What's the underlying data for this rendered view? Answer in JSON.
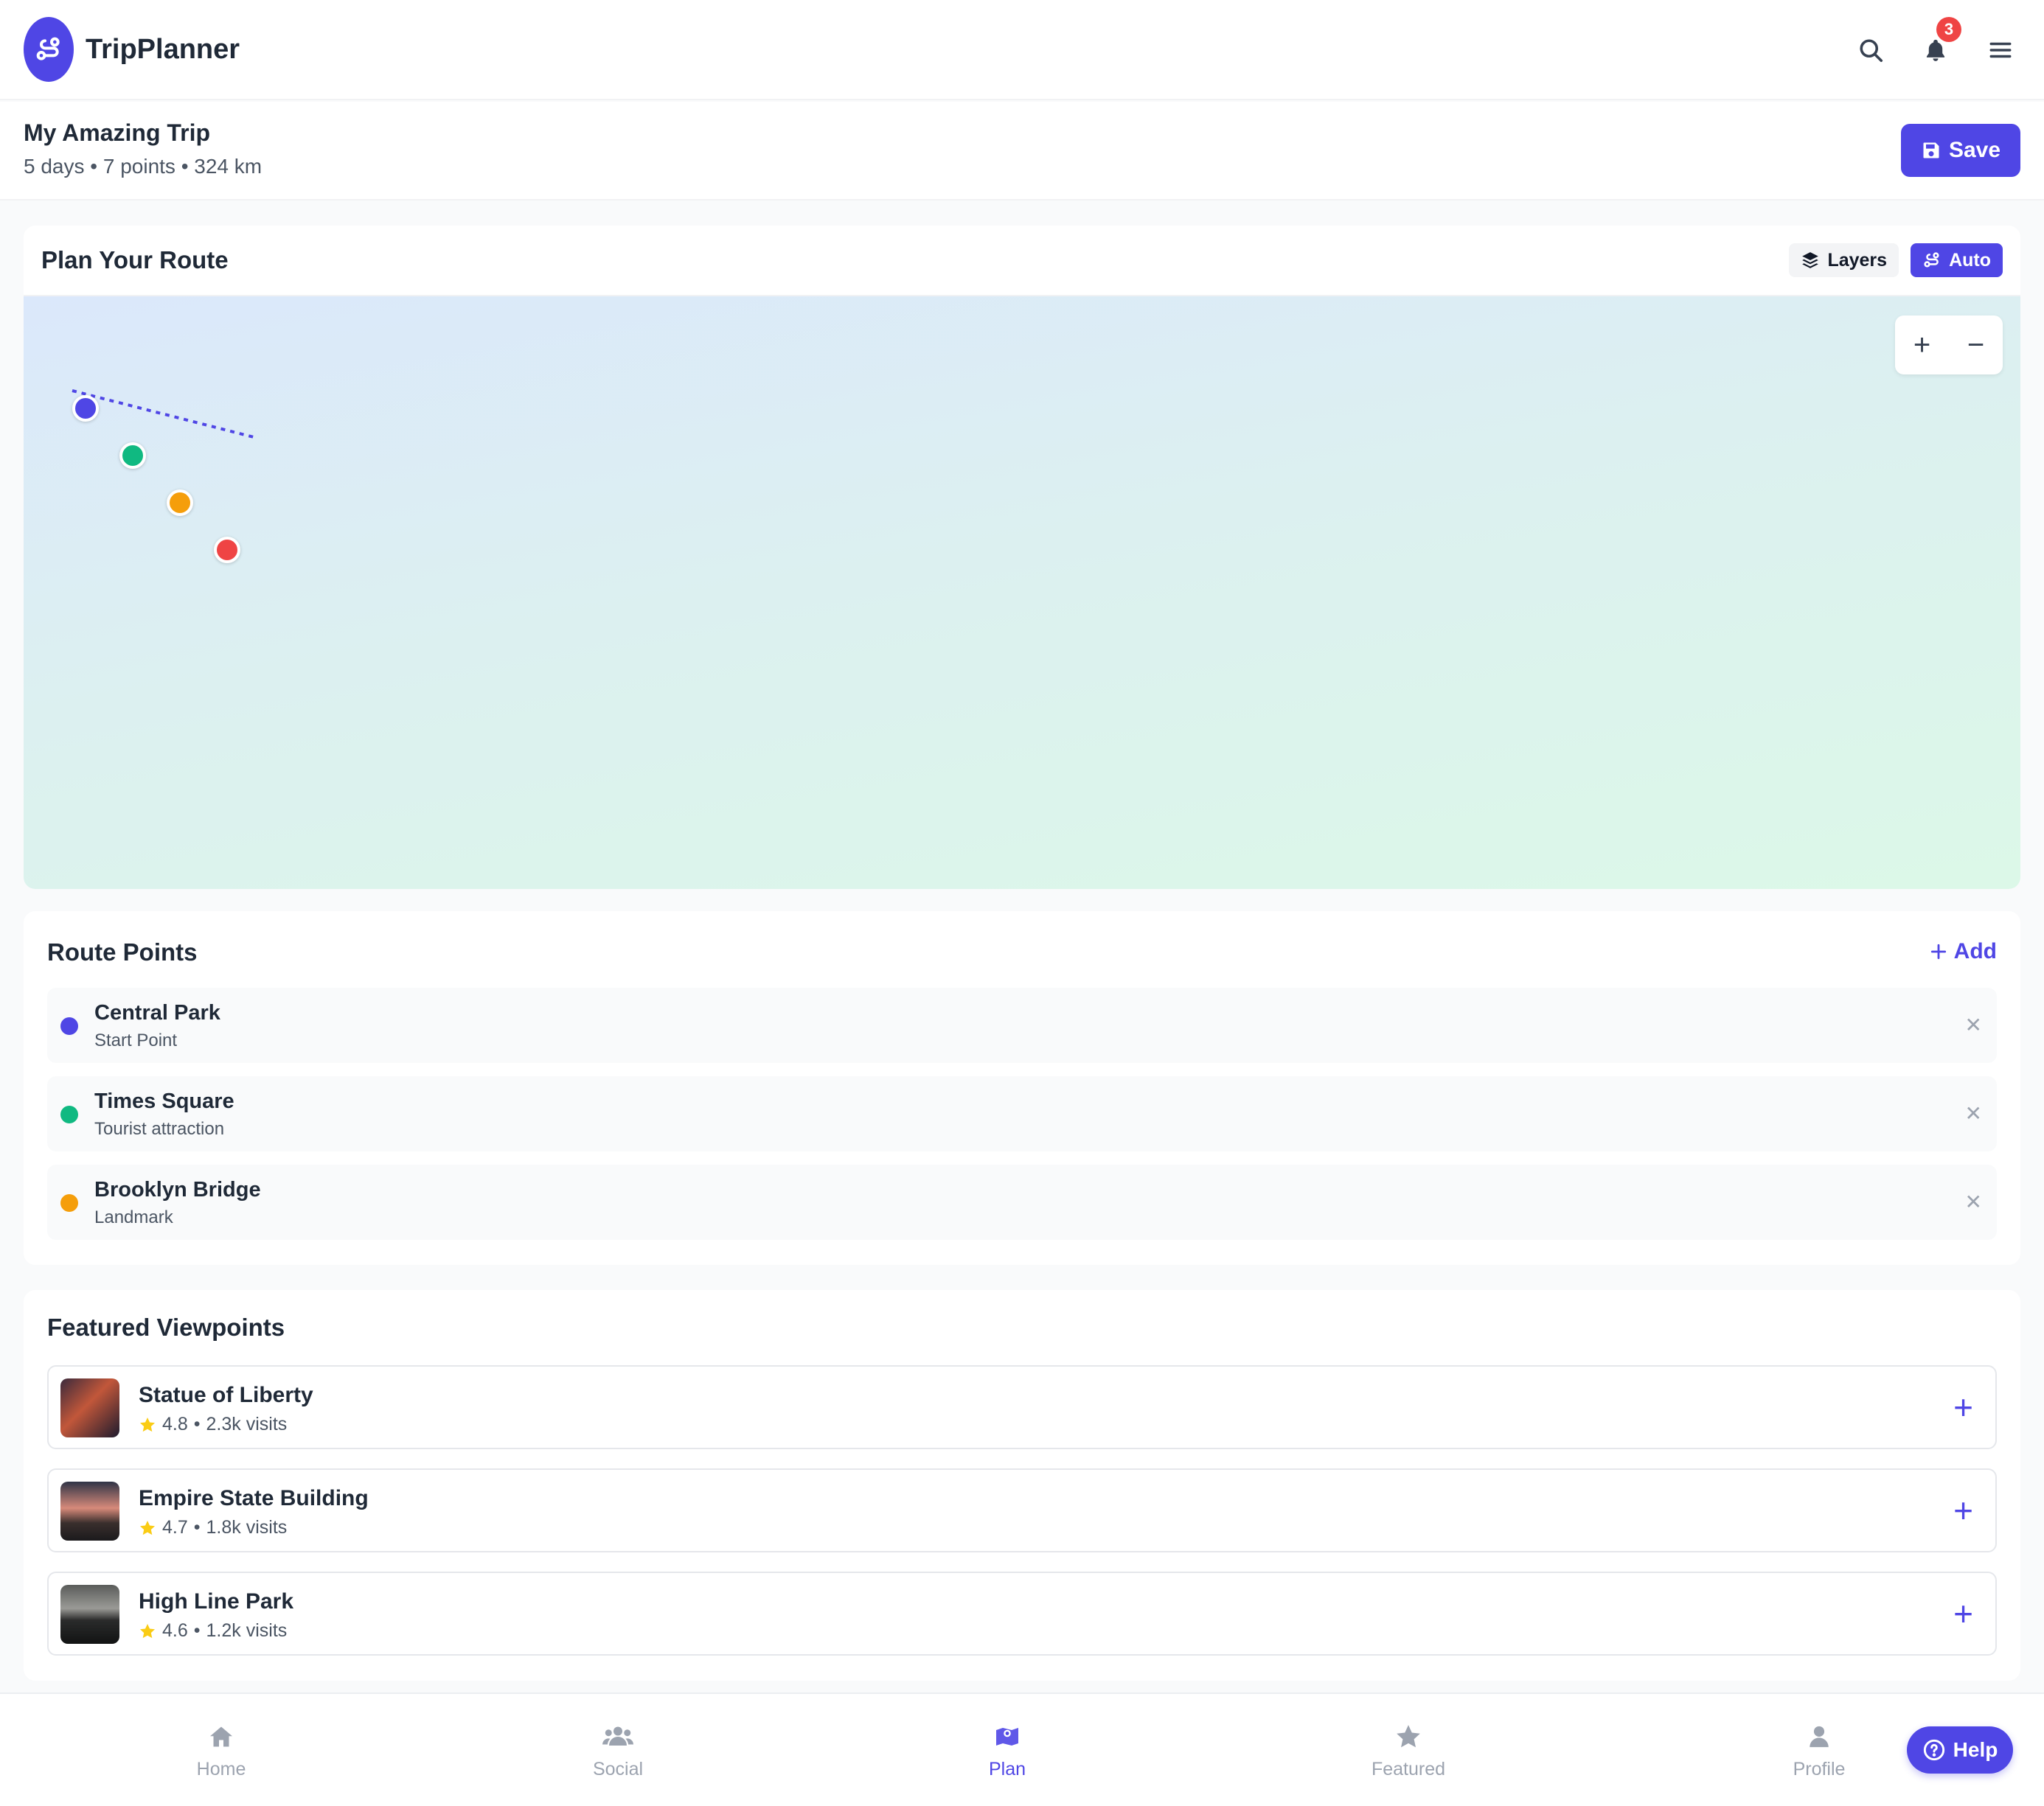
{
  "app": {
    "name": "TripPlanner",
    "notification_count": "3"
  },
  "trip": {
    "title": "My Amazing Trip",
    "meta": "5 days • 7 points • 324 km",
    "save_label": "Save"
  },
  "map": {
    "title": "Plan Your Route",
    "layers_label": "Layers",
    "auto_label": "Auto",
    "zoom_in": "+",
    "zoom_out": "−",
    "marker_colors": [
      "#4f46e5",
      "#10b981",
      "#f59e0b",
      "#ef4444"
    ]
  },
  "route_points": {
    "title": "Route Points",
    "add_label": "Add",
    "items": [
      {
        "name": "Central Park",
        "sub": "Start Point",
        "color": "#4f46e5"
      },
      {
        "name": "Times Square",
        "sub": "Tourist attraction",
        "color": "#10b981"
      },
      {
        "name": "Brooklyn Bridge",
        "sub": "Landmark",
        "color": "#f59e0b"
      }
    ]
  },
  "featured": {
    "title": "Featured Viewpoints",
    "items": [
      {
        "name": "Statue of Liberty",
        "rating": "4.8",
        "visits": "2.3k visits"
      },
      {
        "name": "Empire State Building",
        "rating": "4.7",
        "visits": "1.8k visits"
      },
      {
        "name": "High Line Park",
        "rating": "4.6",
        "visits": "1.2k visits"
      }
    ]
  },
  "nav": {
    "items": [
      {
        "label": "Home",
        "icon": "home-icon"
      },
      {
        "label": "Social",
        "icon": "users-icon"
      },
      {
        "label": "Plan",
        "icon": "map-icon",
        "active": true
      },
      {
        "label": "Featured",
        "icon": "star-icon"
      },
      {
        "label": "Profile",
        "icon": "user-icon"
      }
    ]
  },
  "help_label": "Help",
  "colors": {
    "accent": "#4f46e5",
    "danger": "#ef4444",
    "success": "#10b981",
    "warning": "#f59e0b"
  }
}
